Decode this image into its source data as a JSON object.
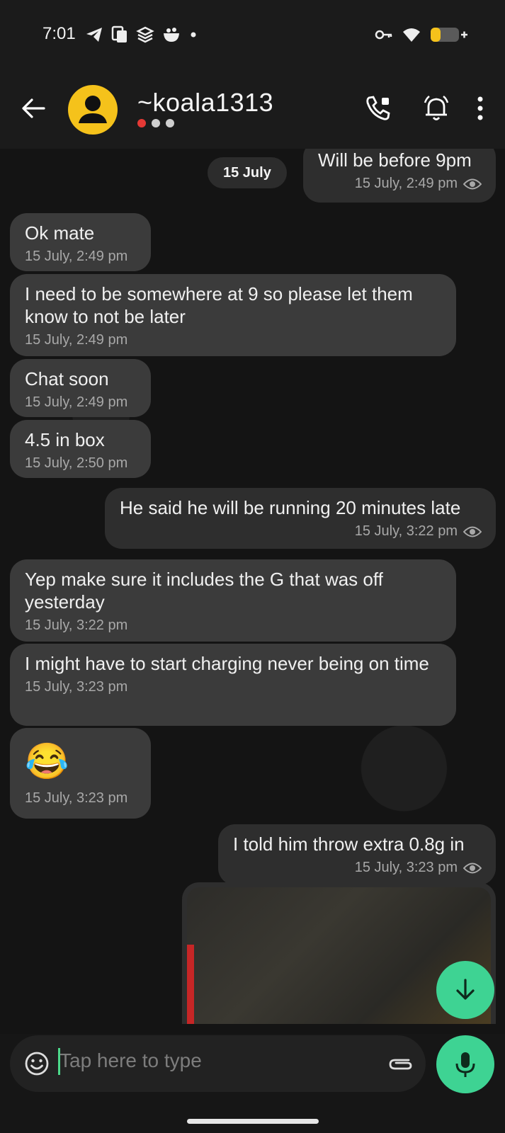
{
  "status_bar": {
    "time": "7:01",
    "left_icons": [
      "telegram-icon",
      "cards-icon",
      "stacked-icon",
      "bowl-icon",
      "dot-icon"
    ],
    "right_icons": [
      "key-icon",
      "wifi-icon",
      "battery-icon"
    ]
  },
  "header": {
    "contact_name": "~koala1313",
    "actions": [
      "call-icon",
      "notification-bell-icon",
      "more-options-icon"
    ]
  },
  "chat": {
    "date_chip": "15 July",
    "messages": [
      {
        "dir": "out",
        "text": "Will be before 9pm",
        "time": "15 July, 2:49 pm"
      },
      {
        "dir": "in",
        "text": "Ok mate",
        "time": "15 July, 2:49 pm"
      },
      {
        "dir": "in",
        "text": "I need to be somewhere at 9 so please let them know to not be later",
        "time": "15 July, 2:49 pm"
      },
      {
        "dir": "in",
        "text": "Chat soon",
        "time": "15 July, 2:49 pm"
      },
      {
        "dir": "in",
        "text": "4.5 in box",
        "time": "15 July, 2:50 pm"
      },
      {
        "dir": "out",
        "text": "He said he will be running 20 minutes late",
        "time": "15 July, 3:22 pm"
      },
      {
        "dir": "in",
        "text": "Yep make sure it includes the G that was off yesterday",
        "time": "15 July, 3:22 pm"
      },
      {
        "dir": "in",
        "text": "I might have to start charging never being on time",
        "time": "15 July, 3:23 pm"
      },
      {
        "dir": "in",
        "text": "😂",
        "time": "15 July, 3:23 pm"
      },
      {
        "dir": "out",
        "text": "I told him throw extra 0.8g in",
        "time": "15 July, 3:23 pm"
      }
    ]
  },
  "composer": {
    "placeholder": "Tap here to type"
  },
  "colors": {
    "accent": "#3ed393",
    "avatar": "#f5c21b",
    "incoming_bubble": "#3b3b3b",
    "outgoing_bubble": "#2e2e2e"
  }
}
